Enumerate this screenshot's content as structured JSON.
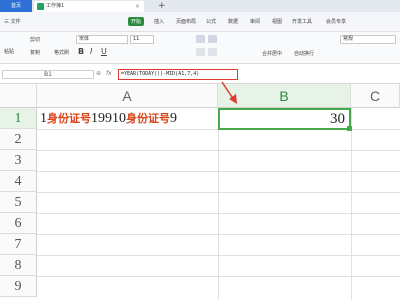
{
  "titlebar": {
    "home_tab": "首页",
    "doc_tab": "工作簿1",
    "doc_close": "×",
    "new_tab": "+"
  },
  "menu": {
    "file": "三 文件",
    "items": [
      "开始",
      "插入",
      "页面布局",
      "公式",
      "数据",
      "审阅",
      "视图",
      "开发工具",
      "会员专享"
    ],
    "active_index": 0
  },
  "toolbar": {
    "paste": "粘贴",
    "cut": "剪切",
    "copy": "复制",
    "format_painter": "格式刷",
    "font_name": "宋体",
    "font_size": "11",
    "bold": "B",
    "italic": "I",
    "underline": "U",
    "number_format": "常规",
    "merge_center": "合并居中",
    "wrap_text": "自动换行"
  },
  "formula_bar": {
    "name_box": "B1",
    "fx": "fx",
    "formula": "=YEAR(TODAY())-MID(A1,7,4)"
  },
  "sheet": {
    "columns": [
      "A",
      "B",
      "C"
    ],
    "rows": [
      "1",
      "2",
      "3",
      "4",
      "5",
      "6",
      "7",
      "8",
      "9"
    ],
    "cell_a1_parts": [
      "1",
      "身份证号",
      "19910",
      "身份证号",
      "9"
    ],
    "cell_b1": "30"
  },
  "colors": {
    "accent": "#2b8a3e",
    "selection": "#45a84a",
    "annotation": "#e53935"
  }
}
